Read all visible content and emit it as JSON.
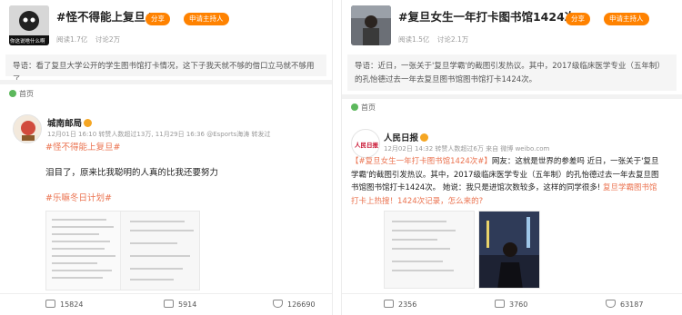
{
  "left": {
    "topic": {
      "title": "#怪不得能上复旦#",
      "thumb_caption": "你这说啥什么啊",
      "read_stat": "阅读1.7亿",
      "discuss_stat": "讨论2万",
      "share_label": "分享",
      "host_label": "申请主持人"
    },
    "intro": {
      "label": "导语：",
      "text": "看了复旦大学公开的学生图书馆打卡情况，这下子我天就不够的借口立马就不够用了"
    },
    "home_label": "首页",
    "post": {
      "user": "城南邮局",
      "meta": "12月01日 16:10 转赞人数超过13万, 11月29日 16:36 @Esports海涛 转发过",
      "hashtag_line": "#怪不得能上复旦#",
      "text": "泪目了，原来比我聪明的人真的比我还要努力",
      "tag2": "#乐嘛冬日计划#",
      "reposts": "15824",
      "comments": "5914",
      "likes": "126690"
    }
  },
  "right": {
    "topic": {
      "title": "#复旦女生一年打卡图书馆1424次#",
      "read_stat": "阅读1.5亿",
      "discuss_stat": "讨论2.1万",
      "share_label": "分享",
      "host_label": "申请主持人"
    },
    "intro": {
      "label": "导语：",
      "text": "近日，一张关于'复旦学霸'的截图引发热议。其中，2017级临床医学专业（五年制）的孔怡德过去一年去复旦图书馆图书馆打卡1424次。"
    },
    "home_label": "首页",
    "post": {
      "user": "人民日报",
      "avatar_text": "人民日报",
      "meta": "12月02日 14:32 转赞人数超过6万 来自 微博 weibo.com",
      "hashtag_line": "【#复旦女生一年打卡图书馆1424次#】",
      "text_a": "网友：这就是世界的参差吗",
      "text_b": "近日，一张关于'复旦学霸'的截图引发热议。其中，2017级临床医学专业（五年制）的孔怡德过去一年去复旦图书馆图书馆打卡1424次。",
      "text_c": "她说：我只是进馆次数较多，这样的同学很多!",
      "link_text": "复旦学霸图书馆打卡上热搜！1424次记录，怎么来的?",
      "reposts": "2356",
      "comments": "3760",
      "likes": "63187"
    }
  },
  "colors": {
    "accent": "#ff8200",
    "hashtag": "#eb7350"
  }
}
